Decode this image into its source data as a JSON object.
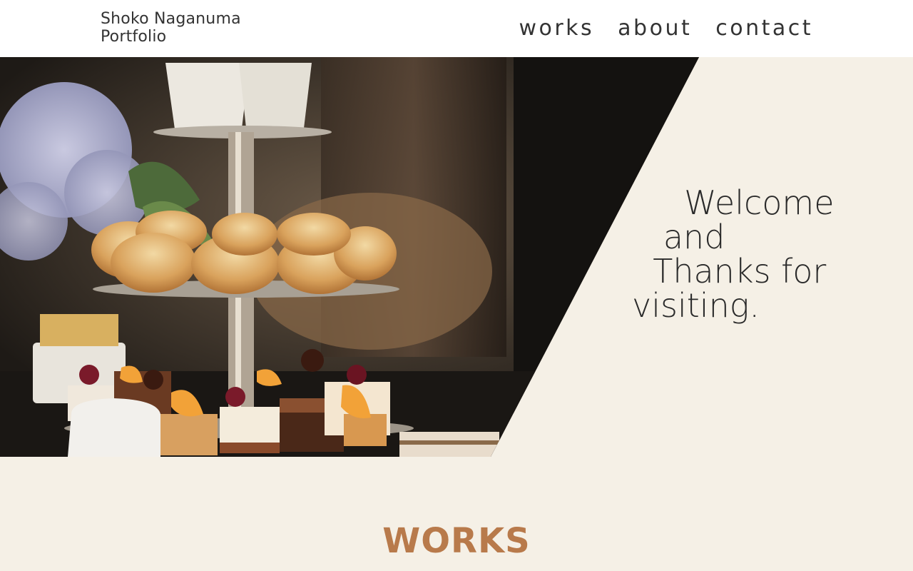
{
  "header": {
    "logo_line1": "Shoko Naganuma",
    "logo_line2": "Portfolio",
    "nav": [
      {
        "label": "works"
      },
      {
        "label": "about"
      },
      {
        "label": "contact"
      }
    ]
  },
  "hero": {
    "welcome_text": "     Welcome\n   and\n  Thanks for\nvisiting."
  },
  "works": {
    "title": "WORKS"
  },
  "colors": {
    "background": "#f5f0e6",
    "header": "#ffffff",
    "accent": "#b87a4b",
    "text": "#2b2b2b"
  }
}
